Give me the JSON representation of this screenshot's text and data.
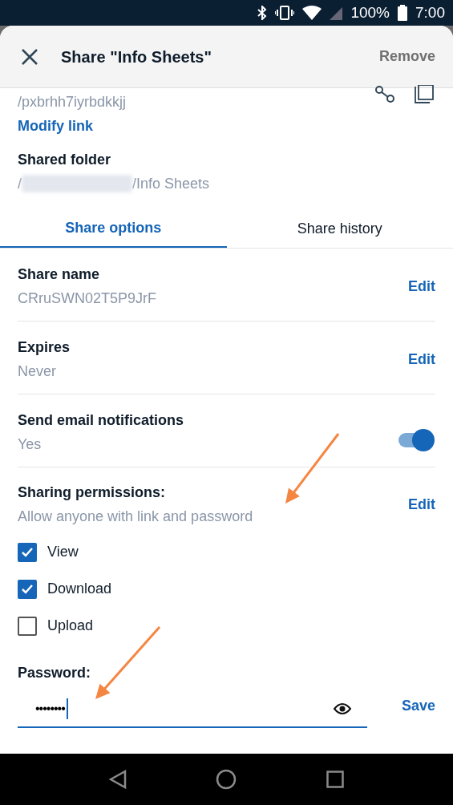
{
  "status_bar": {
    "battery": "100%",
    "time": "7:00"
  },
  "header": {
    "title": "Share \"Info Sheets\"",
    "action": "Remove"
  },
  "link": {
    "url_tail": "/pxbrhh7iyrbdkkjj",
    "modify": "Modify link"
  },
  "shared_folder": {
    "label": "Shared folder",
    "path_start": "/",
    "path_end": "/Info Sheets"
  },
  "tabs": [
    {
      "label": "Share options",
      "selected": true
    },
    {
      "label": "Share history",
      "selected": false
    }
  ],
  "settings": [
    {
      "kind": "edit",
      "label": "Share name",
      "value": "CRruSWN02T5P9JrF",
      "action": "Edit"
    },
    {
      "kind": "edit",
      "label": "Expires",
      "value": "Never",
      "action": "Edit"
    },
    {
      "kind": "toggle",
      "label": "Send email notifications",
      "value": "Yes",
      "on": true
    }
  ],
  "permissions": {
    "label": "Sharing permissions:",
    "value": "Allow anyone with link and password",
    "action": "Edit",
    "options": [
      {
        "label": "View",
        "checked": true
      },
      {
        "label": "Download",
        "checked": true
      },
      {
        "label": "Upload",
        "checked": false
      }
    ]
  },
  "password": {
    "label": "Password:",
    "value": "••••••••",
    "action": "Save"
  }
}
